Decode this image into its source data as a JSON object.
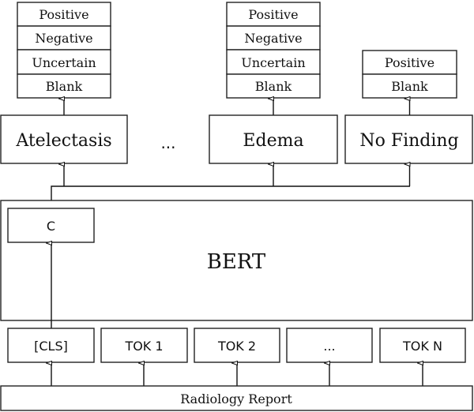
{
  "outputs": [
    {
      "finding": "Atelectasis",
      "labels": [
        "Positive",
        "Negative",
        "Uncertain",
        "Blank"
      ]
    },
    {
      "finding": "Edema",
      "labels": [
        "Positive",
        "Negative",
        "Uncertain",
        "Blank"
      ]
    },
    {
      "finding": "No Finding",
      "labels": [
        "Positive",
        "Blank"
      ]
    }
  ],
  "findings_ellipsis": "...",
  "bert": {
    "label": "BERT",
    "cls_output": "C"
  },
  "tokens": [
    "[CLS]",
    "TOK 1",
    "TOK 2",
    "...",
    "TOK N"
  ],
  "input": {
    "label": "Radiology Report"
  },
  "colors": {
    "stroke": "#222222",
    "background": "#ffffff",
    "text": "#111111"
  }
}
